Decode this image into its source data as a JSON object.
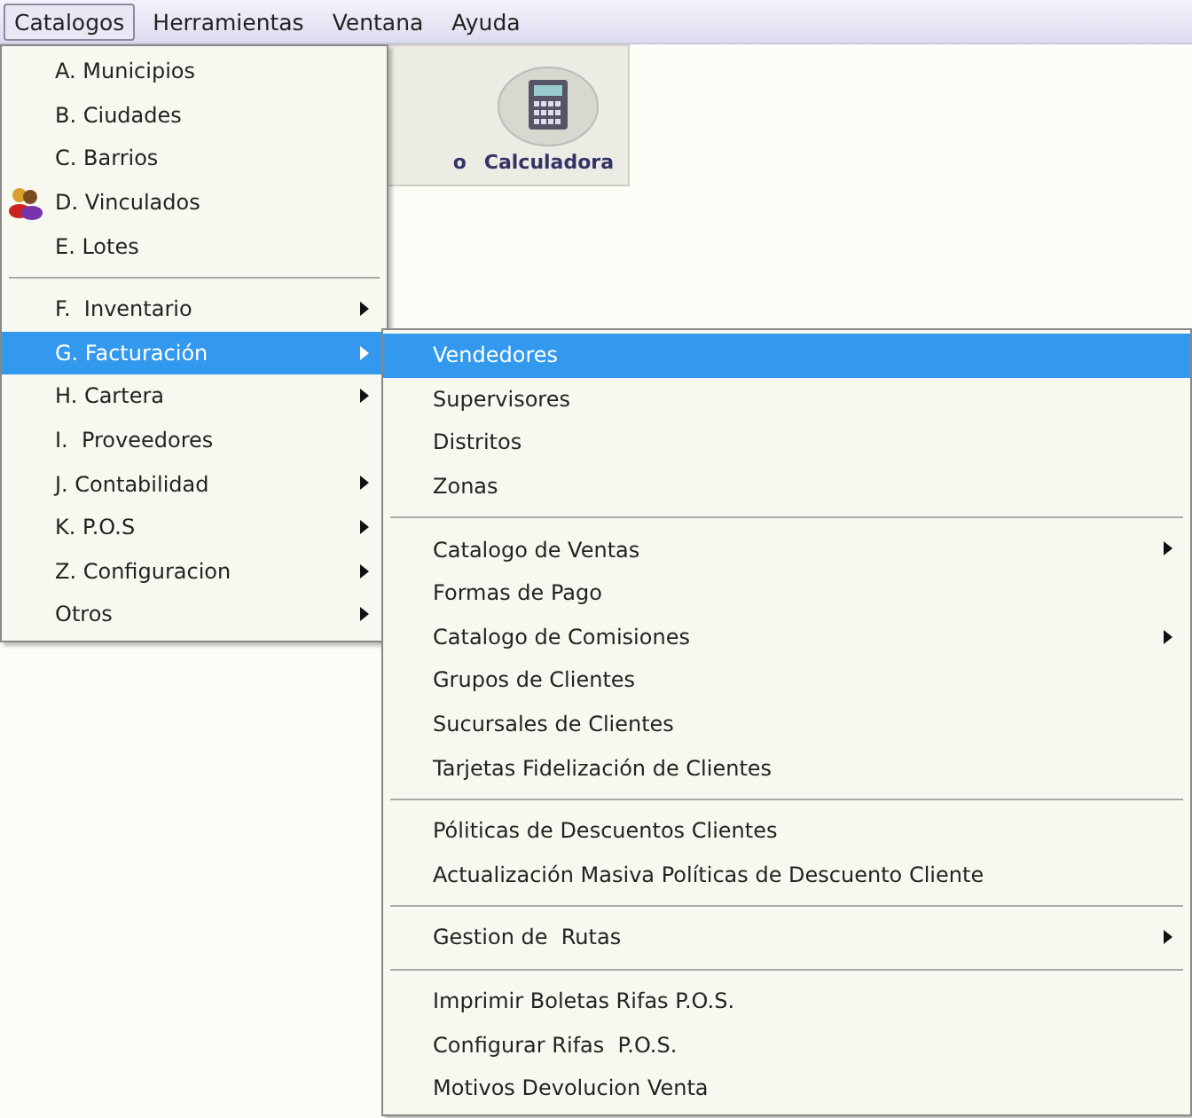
{
  "menu_bar": [
    {
      "label": "Catalogos",
      "selected": true
    },
    {
      "label": "Herramientas",
      "selected": false
    },
    {
      "label": "Ventana",
      "selected": false
    },
    {
      "label": "Ayuda",
      "selected": false
    }
  ],
  "toolbar": [
    {
      "label": "o",
      "kind": "clipped"
    },
    {
      "label": "Calculadora",
      "kind": "calculator"
    }
  ],
  "dropdown": [
    {
      "kind": "item",
      "label": "A. Municipios",
      "selected": false,
      "submenu": false
    },
    {
      "kind": "item",
      "label": "B. Ciudades",
      "selected": false,
      "submenu": false
    },
    {
      "kind": "item",
      "label": "C. Barrios",
      "selected": false,
      "submenu": false
    },
    {
      "kind": "item",
      "label": "D. Vinculados",
      "selected": false,
      "submenu": false,
      "has_icon": true
    },
    {
      "kind": "item",
      "label": "E. Lotes",
      "selected": false,
      "submenu": false
    },
    {
      "kind": "separator"
    },
    {
      "kind": "item",
      "label": "F.  Inventario",
      "selected": false,
      "submenu": true
    },
    {
      "kind": "item",
      "label": "G. Facturación",
      "selected": true,
      "submenu": true
    },
    {
      "kind": "item",
      "label": "H. Cartera",
      "selected": false,
      "submenu": true
    },
    {
      "kind": "item",
      "label": "I.  Proveedores",
      "selected": false,
      "submenu": false
    },
    {
      "kind": "item",
      "label": "J. Contabilidad",
      "selected": false,
      "submenu": true
    },
    {
      "kind": "item",
      "label": "K. P.O.S",
      "selected": false,
      "submenu": true
    },
    {
      "kind": "item",
      "label": "Z. Configuracion",
      "selected": false,
      "submenu": true
    },
    {
      "kind": "item",
      "label": "Otros",
      "selected": false,
      "submenu": true
    }
  ],
  "submenu": [
    {
      "kind": "item",
      "label": "Vendedores",
      "selected": true,
      "submenu": false
    },
    {
      "kind": "item",
      "label": "Supervisores",
      "selected": false,
      "submenu": false
    },
    {
      "kind": "item",
      "label": "Distritos",
      "selected": false,
      "submenu": false
    },
    {
      "kind": "item",
      "label": "Zonas",
      "selected": false,
      "submenu": false
    },
    {
      "kind": "separator"
    },
    {
      "kind": "item",
      "label": "Catalogo de Ventas",
      "selected": false,
      "submenu": true
    },
    {
      "kind": "item",
      "label": "Formas de Pago",
      "selected": false,
      "submenu": false
    },
    {
      "kind": "item",
      "label": "Catalogo de Comisiones",
      "selected": false,
      "submenu": true
    },
    {
      "kind": "item",
      "label": "Grupos de Clientes",
      "selected": false,
      "submenu": false
    },
    {
      "kind": "item",
      "label": "Sucursales de Clientes",
      "selected": false,
      "submenu": false
    },
    {
      "kind": "item",
      "label": "Tarjetas Fidelización de Clientes",
      "selected": false,
      "submenu": false
    },
    {
      "kind": "separator"
    },
    {
      "kind": "item",
      "label": "Póliticas de Descuentos Clientes",
      "selected": false,
      "submenu": false
    },
    {
      "kind": "item",
      "label": "Actualización Masiva Políticas de Descuento Cliente",
      "selected": false,
      "submenu": false
    },
    {
      "kind": "separator"
    },
    {
      "kind": "item",
      "label": "Gestion de  Rutas",
      "selected": false,
      "submenu": true
    },
    {
      "kind": "separator"
    },
    {
      "kind": "item",
      "label": "Imprimir Boletas Rifas P.O.S.",
      "selected": false,
      "submenu": false
    },
    {
      "kind": "item",
      "label": "Configurar Rifas  P.O.S.",
      "selected": false,
      "submenu": false
    },
    {
      "kind": "item",
      "label": "Motivos Devolucion Venta",
      "selected": false,
      "submenu": false
    }
  ]
}
